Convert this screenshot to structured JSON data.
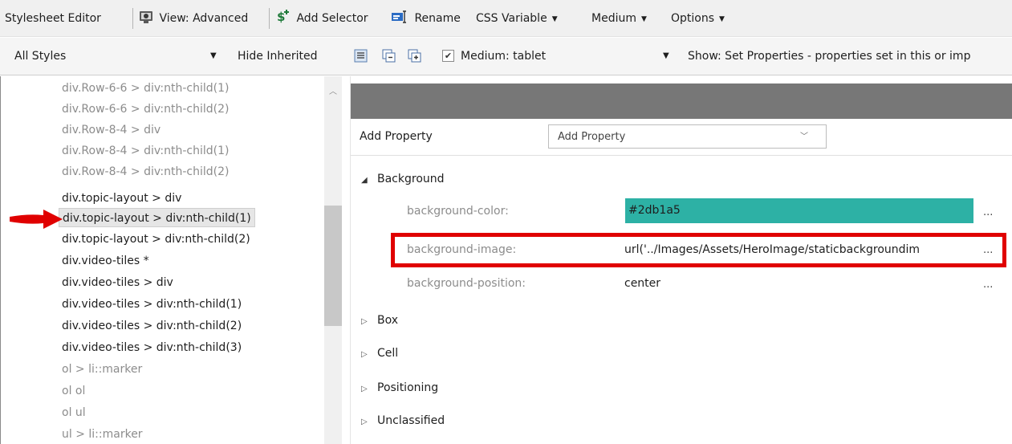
{
  "toolbar": {
    "title": "Stylesheet Editor",
    "view_label": "View: Advanced",
    "add_selector_label": "Add Selector",
    "rename_label": "Rename",
    "css_variable_label": "CSS Variable",
    "medium_label": "Medium",
    "options_label": "Options"
  },
  "filterbar": {
    "styles_select": "All Styles",
    "hide_inherited": "Hide Inherited",
    "medium_tablet_checked": true,
    "medium_tablet_label": "Medium: tablet",
    "show_select": "Show: Set Properties - properties set in this or imp"
  },
  "selectors": [
    {
      "label": "div.Row-6-6 > div:nth-child(1)",
      "state": "inherited"
    },
    {
      "label": "div.Row-6-6 > div:nth-child(2)",
      "state": "inherited"
    },
    {
      "label": "div.Row-8-4 > div",
      "state": "inherited"
    },
    {
      "label": "div.Row-8-4 > div:nth-child(1)",
      "state": "inherited"
    },
    {
      "label": "div.Row-8-4 > div:nth-child(2)",
      "state": "inherited"
    },
    {
      "label": "div.topic-layout > div",
      "state": "normal"
    },
    {
      "label": "div.topic-layout > div:nth-child(1)",
      "state": "selected"
    },
    {
      "label": "div.topic-layout > div:nth-child(2)",
      "state": "normal"
    },
    {
      "label": "div.video-tiles *",
      "state": "normal"
    },
    {
      "label": "div.video-tiles > div",
      "state": "normal"
    },
    {
      "label": "div.video-tiles > div:nth-child(1)",
      "state": "normal"
    },
    {
      "label": "div.video-tiles > div:nth-child(2)",
      "state": "normal"
    },
    {
      "label": "div.video-tiles > div:nth-child(3)",
      "state": "normal"
    },
    {
      "label": "ol > li::marker",
      "state": "inherited"
    },
    {
      "label": "ol ol",
      "state": "inherited"
    },
    {
      "label": "ol ul",
      "state": "inherited"
    },
    {
      "label": "ul > li::marker",
      "state": "inherited"
    }
  ],
  "properties": {
    "add_property_label": "Add Property",
    "add_property_placeholder": "Add Property",
    "categories": {
      "background": "Background",
      "box": "Box",
      "cell": "Cell",
      "positioning": "Positioning",
      "unclassified": "Unclassified"
    },
    "background": [
      {
        "name": "background-color:",
        "value": "#2db1a5",
        "more": "..."
      },
      {
        "name": "background-image:",
        "value": "url('../Images/Assets/HeroImage/staticbackgroundim",
        "more": "..."
      },
      {
        "name": "background-position:",
        "value": "center",
        "more": "..."
      }
    ]
  },
  "colors": {
    "swatch": "#2db1a5",
    "highlight": "#e00000",
    "arrow": "#e00000"
  }
}
